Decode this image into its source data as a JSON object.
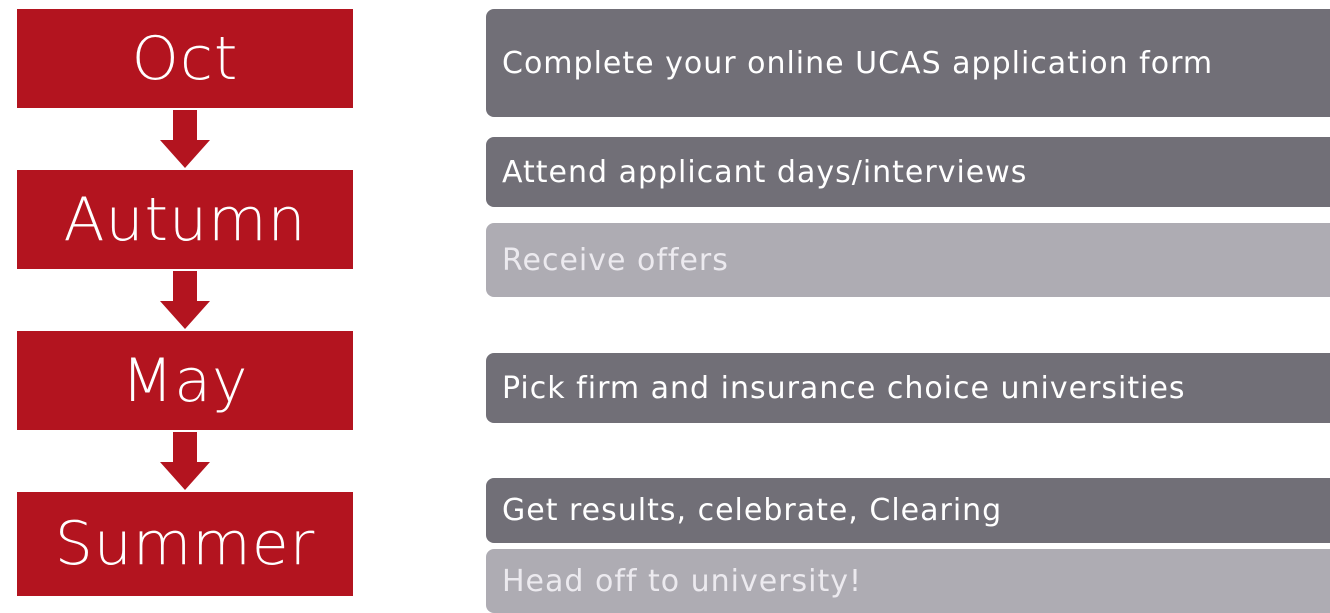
{
  "stages": [
    {
      "label": "Oct"
    },
    {
      "label": "Autumn"
    },
    {
      "label": "May"
    },
    {
      "label": "Summer"
    }
  ],
  "tasks": [
    {
      "label": "Complete your online UCAS application form",
      "tone": "dark"
    },
    {
      "label": "Attend applicant days/interviews",
      "tone": "dark"
    },
    {
      "label": "Receive offers",
      "tone": "light"
    },
    {
      "label": "Pick firm and insurance choice universities",
      "tone": "dark"
    },
    {
      "label": "Get results, celebrate, Clearing",
      "tone": "dark"
    },
    {
      "label": "Head off to university!",
      "tone": "light"
    }
  ],
  "colors": {
    "stage": "#b3141f",
    "task_dark": "#716f77",
    "task_light": "#aeacb3"
  }
}
